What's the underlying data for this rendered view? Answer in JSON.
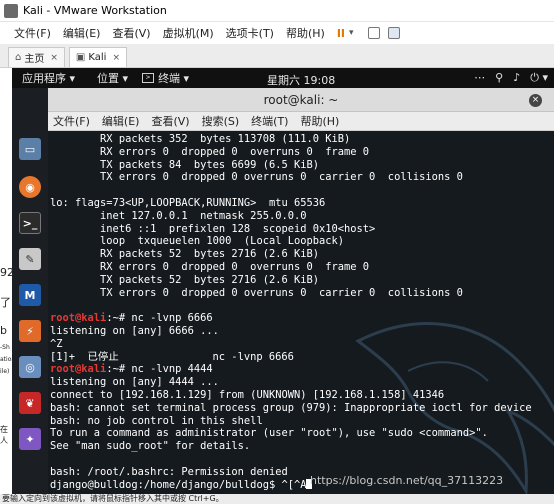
{
  "vmware": {
    "title": "Kali - VMware Workstation",
    "menu": [
      "文件(F)",
      "编辑(E)",
      "查看(V)",
      "虚拟机(M)",
      "选项卡(T)",
      "帮助(H)"
    ],
    "pause_glyph": "II",
    "caret": "▾",
    "tabs": [
      {
        "label": "主页",
        "icon": "home-icon"
      },
      {
        "label": "Kali",
        "icon": "vm-icon"
      }
    ],
    "tab_close": "×",
    "status": "要输入定向到该虚拟机，请将鼠标指针移入其中或按 Ctrl+G。"
  },
  "host_fragments": [
    "92",
    "了",
    "b",
    "-Sh",
    "ation",
    "ile)",
    "在人"
  ],
  "gnome": {
    "apps_menu": "应用程序 ▾",
    "places_menu": "位置 ▾",
    "terminal_menu": "终端 ▾",
    "clock": "星期六 19:08",
    "tray": [
      "⋯",
      "⚲",
      "♪",
      "⏻ ▾"
    ]
  },
  "dash": {
    "icons": [
      {
        "name": "files-icon",
        "glyph": "▭",
        "color": "#5b7fa6"
      },
      {
        "name": "firefox-icon",
        "glyph": "◉",
        "color": "#e8762d"
      },
      {
        "name": "terminal-icon",
        "glyph": ">_",
        "color": "#2b2b2b"
      },
      {
        "name": "text-editor-icon",
        "glyph": "✎",
        "color": "#c8c8c8"
      },
      {
        "name": "metasploit-icon",
        "glyph": "M",
        "color": "#1f5aa8"
      },
      {
        "name": "burpsuite-icon",
        "glyph": "⚡",
        "color": "#e06a2a"
      },
      {
        "name": "maltego-icon",
        "glyph": "◎",
        "color": "#6a8fbf"
      },
      {
        "name": "cherrytree-icon",
        "glyph": "❦",
        "color": "#c62828"
      },
      {
        "name": "faraday-icon",
        "glyph": "✦",
        "color": "#7e57c2"
      }
    ]
  },
  "terminal": {
    "title": "root@kali: ~",
    "close": "×",
    "menu": [
      "文件(F)",
      "编辑(E)",
      "查看(V)",
      "搜索(S)",
      "终端(T)",
      "帮助(H)"
    ],
    "lines": [
      {
        "text": "        RX packets 352  bytes 113708 (111.0 KiB)"
      },
      {
        "text": "        RX errors 0  dropped 0  overruns 0  frame 0"
      },
      {
        "text": "        TX packets 84  bytes 6699 (6.5 KiB)"
      },
      {
        "text": "        TX errors 0  dropped 0 overruns 0  carrier 0  collisions 0"
      },
      {
        "text": ""
      },
      {
        "text": "lo: flags=73<UP,LOOPBACK,RUNNING>  mtu 65536"
      },
      {
        "text": "        inet 127.0.0.1  netmask 255.0.0.0"
      },
      {
        "text": "        inet6 ::1  prefixlen 128  scopeid 0x10<host>"
      },
      {
        "text": "        loop  txqueuelen 1000  (Local Loopback)"
      },
      {
        "text": "        RX packets 52  bytes 2716 (2.6 KiB)"
      },
      {
        "text": "        RX errors 0  dropped 0  overruns 0  frame 0"
      },
      {
        "text": "        TX packets 52  bytes 2716 (2.6 KiB)"
      },
      {
        "text": "        TX errors 0  dropped 0 overruns 0  carrier 0  collisions 0"
      },
      {
        "text": ""
      },
      {
        "prompt": "root@kali",
        "text": ":~# nc -lvnp 6666"
      },
      {
        "text": "listening on [any] 6666 ..."
      },
      {
        "text": "^Z"
      },
      {
        "text": "[1]+  已停止               nc -lvnp 6666"
      },
      {
        "prompt": "root@kali",
        "text": ":~# nc -lvnp 4444"
      },
      {
        "text": "listening on [any] 4444 ..."
      },
      {
        "text": "connect to [192.168.1.129] from (UNKNOWN) [192.168.1.158] 41346"
      },
      {
        "text": "bash: cannot set terminal process group (979): Inappropriate ioctl for device"
      },
      {
        "text": "bash: no job control in this shell"
      },
      {
        "text": "To run a command as administrator (user \"root\"), use \"sudo <command>\"."
      },
      {
        "text": "See \"man sudo_root\" for details."
      },
      {
        "text": ""
      },
      {
        "text": "bash: /root/.bashrc: Permission denied"
      },
      {
        "text": "django@bulldog:/home/django/bulldog$ ^[^A",
        "cursor": true
      }
    ]
  },
  "watermark": "https://blog.csdn.net/qq_37113223"
}
